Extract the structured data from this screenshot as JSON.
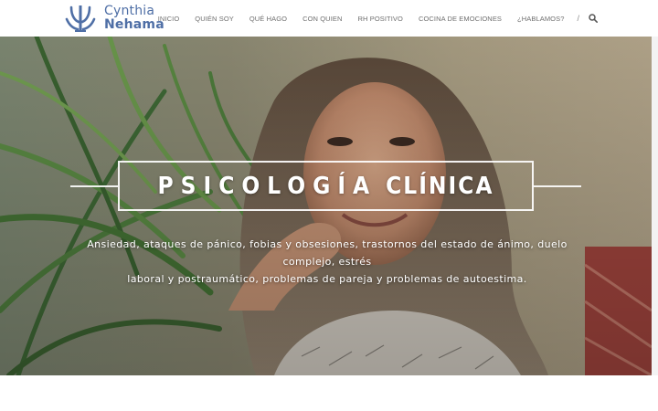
{
  "brand": {
    "line1": "Cynthia",
    "line2": "Nehama",
    "color": "#4f6fa6",
    "icon": "psi-logo-icon"
  },
  "nav": {
    "items": [
      {
        "label": "INICIO"
      },
      {
        "label": "QUIÉN SOY"
      },
      {
        "label": "QUÉ HAGO"
      },
      {
        "label": "CON QUIEN"
      },
      {
        "label": "RH POSITIVO"
      },
      {
        "label": "COCINA DE EMOCIONES"
      },
      {
        "label": "¿HABLAMOS?"
      }
    ],
    "separator": "/",
    "search_icon": "search-icon"
  },
  "hero": {
    "title_word1": "PSICOLOGÍA",
    "title_word2": "CLÍNICA",
    "subtitle_line1": "Ansiedad, ataques de pánico, fobias y obsesiones, trastornos del estado de ánimo, duelo complejo, estrés",
    "subtitle_line2": "laboral y postraumático, problemas de pareja y problemas de autoestima.",
    "image": "portrait-photo-with-plants"
  }
}
